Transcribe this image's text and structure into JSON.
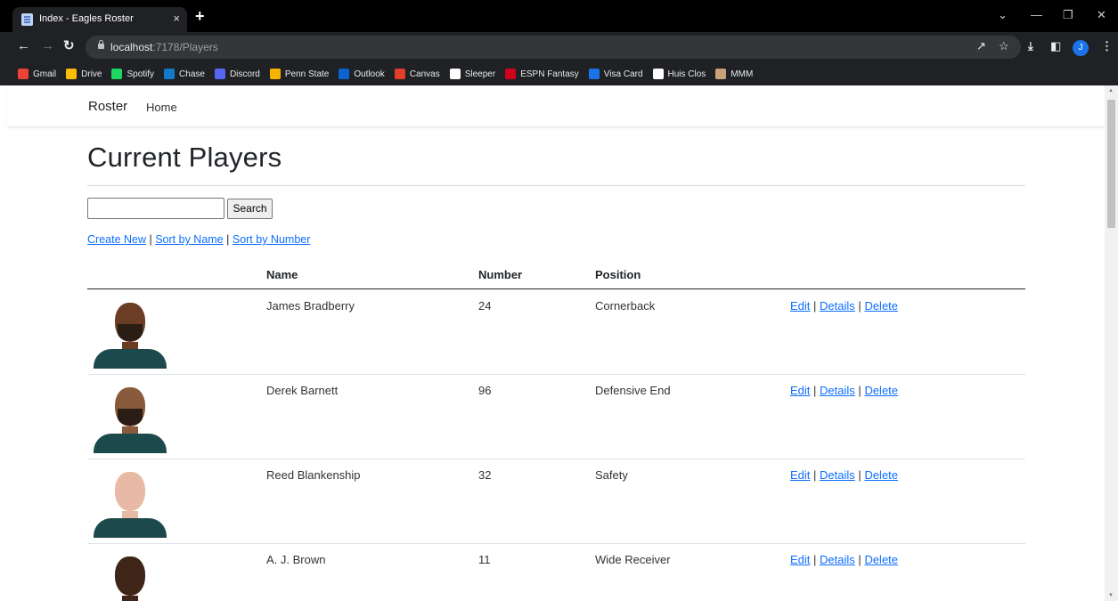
{
  "browser": {
    "tab_title": "Index - Eagles Roster",
    "tab_close": "×",
    "new_tab": "+",
    "url_host": "localhost",
    "url_path": ":7178/Players",
    "avatar_letter": "J",
    "bookmarks": [
      {
        "label": "Gmail",
        "color": "#ea4335"
      },
      {
        "label": "Drive",
        "color": "#fbbc04"
      },
      {
        "label": "Spotify",
        "color": "#1ed760"
      },
      {
        "label": "Chase",
        "color": "#117aca"
      },
      {
        "label": "Discord",
        "color": "#5865f2"
      },
      {
        "label": "Penn State",
        "color": "#f4b400"
      },
      {
        "label": "Outlook",
        "color": "#0a64d0"
      },
      {
        "label": "Canvas",
        "color": "#e13f29"
      },
      {
        "label": "Sleeper",
        "color": "#ffffff"
      },
      {
        "label": "ESPN Fantasy",
        "color": "#d0021b"
      },
      {
        "label": "Visa Card",
        "color": "#1a73e8"
      },
      {
        "label": "Huis Clos",
        "color": "#ffffff"
      },
      {
        "label": "MMM",
        "color": "#c8a07a"
      }
    ]
  },
  "navbar": {
    "brand": "Roster",
    "home": "Home"
  },
  "page": {
    "heading": "Current Players",
    "search_button": "Search",
    "search_value": "",
    "links": {
      "create_new": "Create New",
      "sort_by_name": "Sort by Name",
      "sort_by_number": "Sort by Number",
      "separator": "|"
    }
  },
  "table": {
    "headers": {
      "name": "Name",
      "number": "Number",
      "position": "Position"
    },
    "action_labels": {
      "edit": "Edit",
      "details": "Details",
      "delete": "Delete"
    },
    "rows": [
      {
        "name": "James Bradberry",
        "number": "24",
        "position": "Cornerback",
        "skin": "#6b3d24",
        "beard": true
      },
      {
        "name": "Derek Barnett",
        "number": "96",
        "position": "Defensive End",
        "skin": "#8a5a3c",
        "beard": true
      },
      {
        "name": "Reed Blankenship",
        "number": "32",
        "position": "Safety",
        "skin": "#e8b9a4",
        "beard": false
      },
      {
        "name": "A. J. Brown",
        "number": "11",
        "position": "Wide Receiver",
        "skin": "#3f2418",
        "beard": false
      }
    ]
  }
}
